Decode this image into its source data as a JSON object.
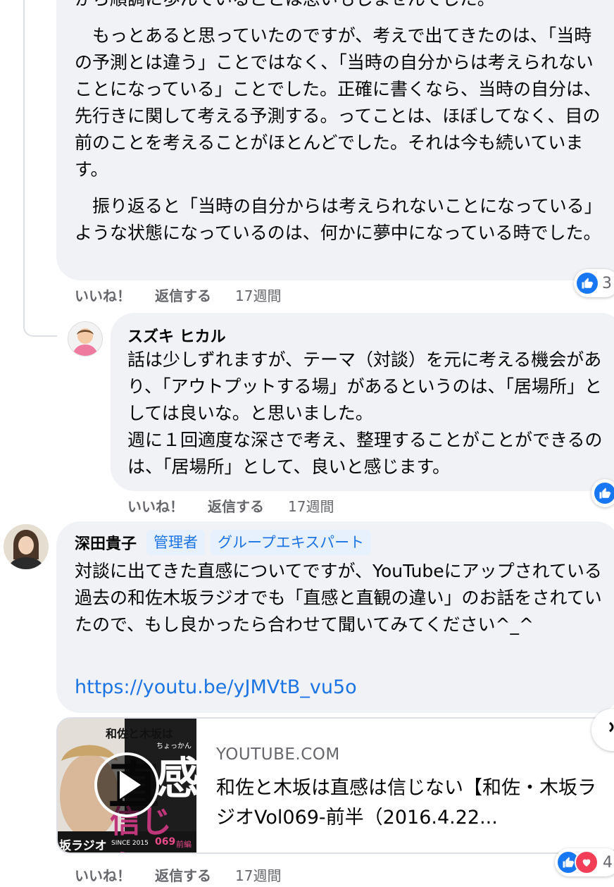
{
  "comment1": {
    "top_partial": "から順調に歩んでいることは思いもしませんでした。",
    "paragraph1": "　もっとあると思っていたのですが、考えで出てきたのは、「当時の予測とは違う」ことではなく、「当時の自分からは考えられないことになっている」ことでした。正確に書くなら、当時の自分は、先行きに関して考える予測する。ってことは、ほぼしてなく、目の前のことを考えることがほとんどでした。それは今も続いています。",
    "paragraph2": "　振り返ると「当時の自分からは考えられないことになっている」ような状態になっているのは、何かに夢中になっている時でした。",
    "like_label": "いいね！",
    "reply_label": "返信する",
    "time": "17週間",
    "reaction_count": "3"
  },
  "comment2": {
    "author": "スズキ ヒカル",
    "text": "話は少しずれますが、テーマ（対談）を元に考える機会があり、「アウトプットする場」があるというのは、「居場所」としては良いな。と思いました。\n週に１回適度な深さで考え、整理することがことができるのは、「居場所」として、良いと感じます。",
    "like_label": "いいね！",
    "reply_label": "返信する",
    "time": "17週間"
  },
  "comment3": {
    "author": "深田貴子",
    "badge_admin": "管理者",
    "badge_expert": "グループエキスパート",
    "text": "対談に出てきた直感についてですが、YouTubeにアップされている過去の和佐木坂ラジオでも「直感と直観の違い」のお話をされていたので、もし良かったら合わせて聞いてみてください^_^",
    "link": "https://youtu.be/yJMVtB_vu5o",
    "card_domain": "YOUTUBE.COM",
    "card_title": "和佐と木坂は直感は信じない【和佐・木坂ラジオVol069-前半（2016.4.22...",
    "thumb_top_text": "和佐と木坂は",
    "thumb_big_1": "直",
    "thumb_big_2": "感",
    "thumb_sub": "信じな",
    "thumb_ruby": "ちょっかん",
    "thumb_footer": "SINCE 2015",
    "thumb_episode": "069",
    "thumb_episode_suffix": "前編",
    "thumb_logo": "坂ラジオ",
    "like_label": "いいね！",
    "reply_label": "返信する",
    "time": "17週間",
    "reaction_count": "4"
  },
  "colors": {
    "bubble": "#f0f2f5",
    "link": "#1b74e4",
    "meta": "#65676b",
    "like_blue": "#1877f2",
    "love_red": "#f33e58"
  }
}
